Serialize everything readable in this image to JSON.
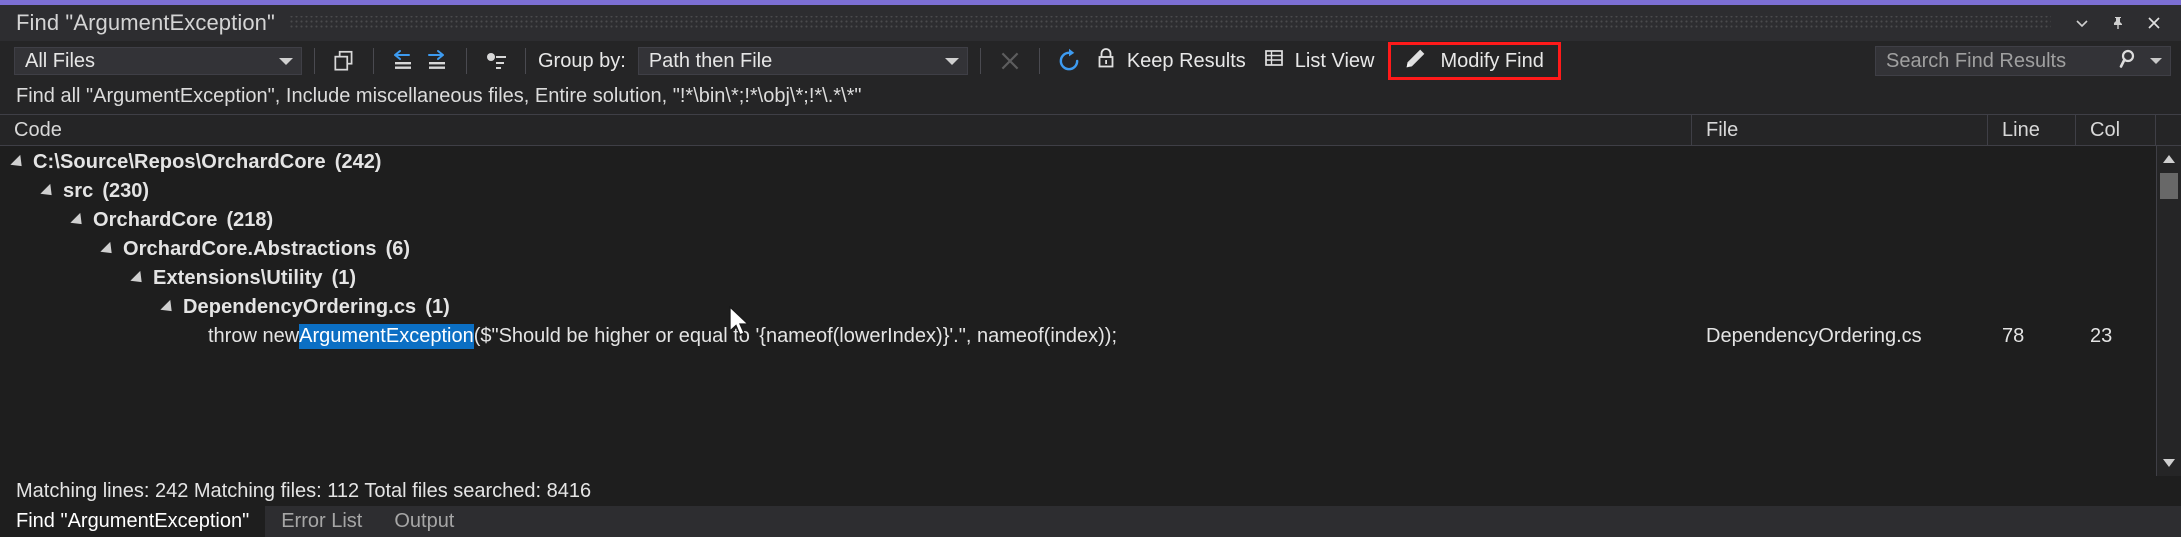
{
  "window": {
    "title": "Find \"ArgumentException\"",
    "accent_color": "#7c6fd4",
    "minimize_label": "Minimize",
    "pin_label": "Pin",
    "close_label": "Close"
  },
  "toolbar": {
    "filter": {
      "value": "All Files"
    },
    "copy_icon": "copy-icon",
    "collapse_icon": "collapse-all-icon",
    "expand_icon": "expand-all-icon",
    "sort_icon": "group-sort-icon",
    "group_by_label": "Group by:",
    "group_by": {
      "value": "Path then File"
    },
    "stop_label": "Stop",
    "refresh_label": "Refresh",
    "keep_results_label": "Keep Results",
    "list_view_label": "List View",
    "modify_find_label": "Modify Find",
    "modify_find_highlight_color": "#ff1a1a",
    "search": {
      "placeholder": "Search Find Results"
    }
  },
  "description": "Find all \"ArgumentException\", Include miscellaneous files, Entire solution, \"!*\\bin\\*;!*\\obj\\*;!*\\.*\\*\"",
  "columns": {
    "code": "Code",
    "file": "File",
    "line": "Line",
    "col": "Col"
  },
  "tree": [
    {
      "label": "C:\\Source\\Repos\\OrchardCore",
      "count": "(242)",
      "depth": 0
    },
    {
      "label": "src",
      "count": "(230)",
      "depth": 1
    },
    {
      "label": "OrchardCore",
      "count": "(218)",
      "depth": 2
    },
    {
      "label": "OrchardCore.Abstractions",
      "count": "(6)",
      "depth": 3
    },
    {
      "label": "Extensions\\Utility",
      "count": "(1)",
      "depth": 4
    },
    {
      "label": "DependencyOrdering.cs",
      "count": "(1)",
      "depth": 5
    }
  ],
  "match": {
    "prefix": "throw new ",
    "highlight": "ArgumentException",
    "suffix": "($\"Should be higher or equal to '{nameof(lowerIndex)}'.\", nameof(index));",
    "highlight_color": "#0b6fc4",
    "file": "DependencyOrdering.cs",
    "line": "78",
    "col": "23"
  },
  "status": "Matching lines: 242 Matching files: 112 Total files searched: 8416",
  "tabs": [
    {
      "label": "Find \"ArgumentException\"",
      "active": true
    },
    {
      "label": "Error List",
      "active": false
    },
    {
      "label": "Output",
      "active": false
    }
  ]
}
